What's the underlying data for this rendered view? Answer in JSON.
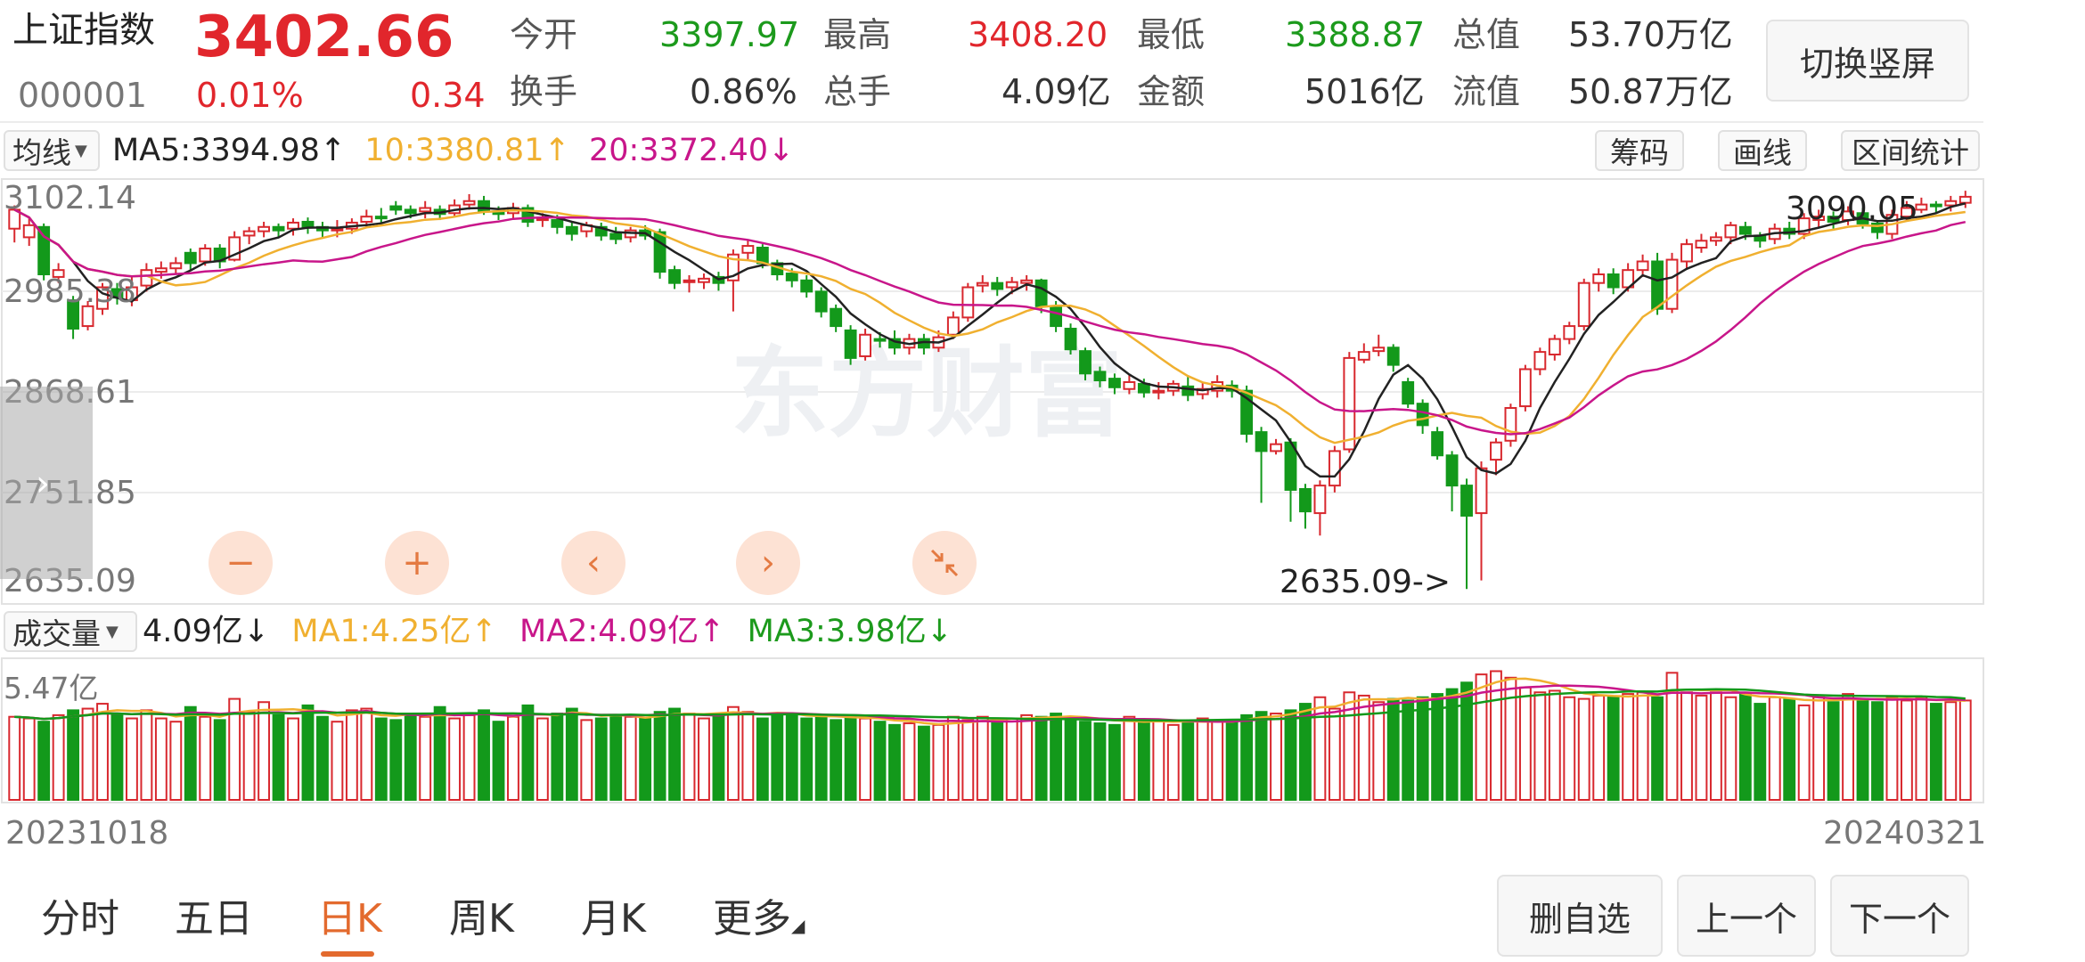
{
  "header": {
    "name": "上证指数",
    "code": "000001",
    "price": "3402.66",
    "change_pct": "0.01%",
    "change": "0.34",
    "stats": [
      {
        "label": "今开",
        "value": "3397.97",
        "color": "green"
      },
      {
        "label": "最高",
        "value": "3408.20",
        "color": "red"
      },
      {
        "label": "最低",
        "value": "3388.87",
        "color": "green"
      },
      {
        "label": "总值",
        "value": "53.70万亿",
        "color": "dark"
      },
      {
        "label": "换手",
        "value": "0.86%",
        "color": "dark"
      },
      {
        "label": "总手",
        "value": "4.09亿",
        "color": "dark"
      },
      {
        "label": "金额",
        "value": "5016亿",
        "color": "dark"
      },
      {
        "label": "流值",
        "value": "50.87万亿",
        "color": "dark"
      }
    ],
    "switch_button": "切换竖屏"
  },
  "price_toolbar": {
    "indicator": "均线",
    "ma5": "MA5:3394.98",
    "ma10": "10:3380.81",
    "ma20": "20:3372.40",
    "ma5_arrow": "↑",
    "ma10_arrow": "↑",
    "ma20_arrow": "↓",
    "btn_chips": "筹码",
    "btn_draw": "画线",
    "btn_range": "区间统计"
  },
  "volume_toolbar": {
    "indicator": "成交量",
    "value": "4.09亿",
    "value_arrow": "↓",
    "ma1": "MA1:4.25亿",
    "ma1_arrow": "↑",
    "ma2": "MA2:4.09亿",
    "ma2_arrow": "↑",
    "ma3": "MA3:3.98亿",
    "ma3_arrow": "↓"
  },
  "watermark": "东方财富",
  "colors": {
    "up": "#d8282e",
    "down": "#13991b",
    "ma5": "#222222",
    "ma10": "#f0b030",
    "ma20": "#c8168a",
    "accent": "#e36a2e"
  },
  "chart_data": {
    "type": "candlestick",
    "y_ticks": [
      "3102.14",
      "2985.38",
      "2868.61",
      "2751.85",
      "2635.09"
    ],
    "ylim": [
      2635.09,
      3102.14
    ],
    "min_label": "2635.09->",
    "max_label": "3090.05",
    "x_start": "20231018",
    "x_end": "20240321",
    "volume_max_label": "5.47亿",
    "candles": [
      [
        3058,
        3080,
        3042,
        3085,
        5.1
      ],
      [
        3048,
        3062,
        3038,
        3070,
        5.0
      ],
      [
        3060,
        3005,
        2998,
        3064,
        4.8
      ],
      [
        3002,
        3010,
        2995,
        3018,
        5.2
      ],
      [
        2975,
        2942,
        2930,
        2980,
        5.5
      ],
      [
        2945,
        2968,
        2940,
        2974,
        5.6
      ],
      [
        2965,
        2990,
        2958,
        2995,
        5.9
      ],
      [
        2988,
        2978,
        2970,
        2995,
        5.3
      ],
      [
        2975,
        2990,
        2968,
        3002,
        5.0
      ],
      [
        2992,
        3010,
        2985,
        3018,
        5.5
      ],
      [
        3008,
        3012,
        3000,
        3020,
        5.0
      ],
      [
        3012,
        3018,
        3005,
        3025,
        4.8
      ],
      [
        3030,
        3018,
        3010,
        3035,
        5.7
      ],
      [
        3020,
        3035,
        3015,
        3040,
        5.1
      ],
      [
        3035,
        3020,
        3012,
        3040,
        4.9
      ],
      [
        3022,
        3048,
        3020,
        3055,
        6.2
      ],
      [
        3050,
        3055,
        3040,
        3060,
        5.4
      ],
      [
        3055,
        3060,
        3048,
        3066,
        6.0
      ],
      [
        3060,
        3056,
        3048,
        3064,
        5.2
      ],
      [
        3058,
        3065,
        3050,
        3070,
        5.0
      ],
      [
        3066,
        3060,
        3052,
        3071,
        5.8
      ],
      [
        3060,
        3056,
        3048,
        3066,
        5.1
      ],
      [
        3058,
        3058,
        3048,
        3068,
        4.8
      ],
      [
        3058,
        3065,
        3052,
        3070,
        5.5
      ],
      [
        3066,
        3072,
        3060,
        3080,
        5.6
      ],
      [
        3072,
        3070,
        3062,
        3082,
        5.0
      ],
      [
        3084,
        3080,
        3074,
        3090,
        4.9
      ],
      [
        3080,
        3076,
        3070,
        3085,
        5.3
      ],
      [
        3078,
        3082,
        3070,
        3090,
        5.1
      ],
      [
        3080,
        3075,
        3068,
        3085,
        5.7
      ],
      [
        3076,
        3085,
        3072,
        3092,
        5.0
      ],
      [
        3086,
        3090,
        3080,
        3098,
        5.2
      ],
      [
        3090,
        3078,
        3074,
        3096,
        5.5
      ],
      [
        3078,
        3075,
        3068,
        3084,
        4.8
      ],
      [
        3076,
        3082,
        3070,
        3088,
        5.1
      ],
      [
        3082,
        3066,
        3060,
        3086,
        5.8
      ],
      [
        3068,
        3070,
        3060,
        3076,
        5.0
      ],
      [
        3068,
        3060,
        3052,
        3074,
        5.3
      ],
      [
        3060,
        3052,
        3044,
        3066,
        5.6
      ],
      [
        3055,
        3062,
        3048,
        3066,
        4.9
      ],
      [
        3060,
        3050,
        3044,
        3065,
        5.0
      ],
      [
        3052,
        3046,
        3040,
        3060,
        5.2
      ],
      [
        3048,
        3056,
        3042,
        3060,
        5.1
      ],
      [
        3056,
        3050,
        3045,
        3062,
        5.0
      ],
      [
        3054,
        3008,
        3000,
        3058,
        5.4
      ],
      [
        3010,
        2995,
        2988,
        3015,
        5.6
      ],
      [
        2996,
        2998,
        2984,
        3004,
        5.3
      ],
      [
        2996,
        3000,
        2988,
        3006,
        5.0
      ],
      [
        3002,
        2995,
        2986,
        3008,
        5.3
      ],
      [
        2998,
        3028,
        2962,
        3034,
        5.7
      ],
      [
        3030,
        3038,
        3022,
        3045,
        5.4
      ],
      [
        3036,
        3018,
        3012,
        3040,
        5.0
      ],
      [
        3018,
        3005,
        2998,
        3022,
        5.3
      ],
      [
        3006,
        2998,
        2990,
        3012,
        5.2
      ],
      [
        2998,
        2985,
        2978,
        3004,
        5.0
      ],
      [
        2985,
        2962,
        2955,
        2990,
        5.2
      ],
      [
        2965,
        2945,
        2938,
        2970,
        4.9
      ],
      [
        2940,
        2908,
        2900,
        2946,
        5.1
      ],
      [
        2910,
        2935,
        2905,
        2942,
        5.0
      ],
      [
        2930,
        2928,
        2920,
        2938,
        4.8
      ],
      [
        2930,
        2920,
        2912,
        2940,
        4.6
      ],
      [
        2920,
        2930,
        2912,
        2936,
        4.7
      ],
      [
        2930,
        2920,
        2912,
        2936,
        4.5
      ],
      [
        2920,
        2932,
        2915,
        2940,
        4.6
      ],
      [
        2935,
        2955,
        2930,
        2962,
        5.1
      ],
      [
        2955,
        2990,
        2950,
        2995,
        4.9
      ],
      [
        2992,
        2995,
        2984,
        3004,
        5.1
      ],
      [
        2995,
        2988,
        2980,
        3002,
        4.8
      ],
      [
        2990,
        2996,
        2982,
        3002,
        5.0
      ],
      [
        2995,
        2998,
        2986,
        3004,
        5.2
      ],
      [
        2998,
        2968,
        2960,
        3000,
        5.1
      ],
      [
        2968,
        2945,
        2938,
        2974,
        5.3
      ],
      [
        2942,
        2918,
        2912,
        2948,
        5.0
      ],
      [
        2916,
        2890,
        2882,
        2920,
        4.8
      ],
      [
        2892,
        2882,
        2874,
        2898,
        4.7
      ],
      [
        2884,
        2874,
        2866,
        2890,
        4.6
      ],
      [
        2872,
        2880,
        2866,
        2888,
        5.1
      ],
      [
        2878,
        2868,
        2862,
        2884,
        4.8
      ],
      [
        2868,
        2870,
        2860,
        2880,
        4.9
      ],
      [
        2870,
        2878,
        2864,
        2882,
        4.6
      ],
      [
        2875,
        2865,
        2858,
        2888,
        4.7
      ],
      [
        2866,
        2872,
        2860,
        2880,
        5.0
      ],
      [
        2870,
        2880,
        2862,
        2888,
        4.8
      ],
      [
        2876,
        2870,
        2862,
        2882,
        4.9
      ],
      [
        2870,
        2820,
        2810,
        2876,
        5.2
      ],
      [
        2822,
        2800,
        2740,
        2828,
        5.4
      ],
      [
        2800,
        2808,
        2796,
        2814,
        5.3
      ],
      [
        2810,
        2755,
        2718,
        2815,
        5.5
      ],
      [
        2756,
        2730,
        2710,
        2762,
        5.9
      ],
      [
        2728,
        2760,
        2702,
        2766,
        6.3
      ],
      [
        2760,
        2800,
        2752,
        2806,
        5.6
      ],
      [
        2802,
        2908,
        2798,
        2915,
        6.6
      ],
      [
        2906,
        2915,
        2902,
        2925,
        6.4
      ],
      [
        2916,
        2920,
        2910,
        2935,
        6.0
      ],
      [
        2920,
        2900,
        2892,
        2924,
        6.2
      ],
      [
        2880,
        2855,
        2850,
        2885,
        6.1
      ],
      [
        2855,
        2830,
        2820,
        2860,
        6.3
      ],
      [
        2822,
        2795,
        2790,
        2828,
        6.5
      ],
      [
        2795,
        2760,
        2730,
        2800,
        6.8
      ],
      [
        2760,
        2725,
        2640,
        2768,
        7.2
      ],
      [
        2728,
        2780,
        2650,
        2788,
        7.7
      ],
      [
        2790,
        2810,
        2772,
        2815,
        7.9
      ],
      [
        2812,
        2850,
        2805,
        2855,
        7.5
      ],
      [
        2852,
        2895,
        2846,
        2900,
        6.9
      ],
      [
        2895,
        2915,
        2888,
        2920,
        6.6
      ],
      [
        2912,
        2930,
        2905,
        2935,
        6.7
      ],
      [
        2930,
        2945,
        2924,
        2950,
        6.3
      ],
      [
        2945,
        2995,
        2940,
        3000,
        6.2
      ],
      [
        2995,
        3005,
        2985,
        3012,
        6.4
      ],
      [
        3005,
        2990,
        2982,
        3012,
        6.3
      ],
      [
        2990,
        3010,
        2985,
        3018,
        6.5
      ],
      [
        3010,
        3020,
        3002,
        3028,
        6.6
      ],
      [
        3020,
        2965,
        2958,
        3030,
        6.3
      ],
      [
        2965,
        3022,
        2960,
        3030,
        7.8
      ],
      [
        3020,
        3040,
        3012,
        3046,
        6.6
      ],
      [
        3036,
        3044,
        3030,
        3052,
        6.4
      ],
      [
        3044,
        3048,
        3038,
        3054,
        6.6
      ],
      [
        3048,
        3062,
        3040,
        3066,
        6.3
      ],
      [
        3060,
        3052,
        3045,
        3066,
        6.5
      ],
      [
        3050,
        3044,
        3036,
        3054,
        5.9
      ],
      [
        3046,
        3058,
        3040,
        3064,
        6.3
      ],
      [
        3058,
        3052,
        3046,
        3066,
        6.2
      ],
      [
        3052,
        3070,
        3046,
        3076,
        5.8
      ],
      [
        3068,
        3072,
        3060,
        3080,
        6.3
      ],
      [
        3072,
        3066,
        3058,
        3078,
        6.0
      ],
      [
        3068,
        3078,
        3062,
        3084,
        6.5
      ],
      [
        3076,
        3064,
        3058,
        3082,
        6.2
      ],
      [
        3064,
        3054,
        3046,
        3068,
        6.0
      ],
      [
        3052,
        3074,
        3046,
        3080,
        6.3
      ],
      [
        3072,
        3082,
        3068,
        3090,
        6.1
      ],
      [
        3080,
        3086,
        3076,
        3094,
        6.3
      ],
      [
        3086,
        3084,
        3076,
        3090,
        5.9
      ],
      [
        3085,
        3090,
        3078,
        3096,
        6.0
      ],
      [
        3088,
        3095,
        3082,
        3102,
        6.1
      ]
    ]
  },
  "bottom_tabs": [
    "分时",
    "五日",
    "日K",
    "周K",
    "月K",
    "更多"
  ],
  "active_tab": "日K",
  "nav_buttons": {
    "remove": "删自选",
    "prev": "上一个",
    "next": "下一个"
  }
}
